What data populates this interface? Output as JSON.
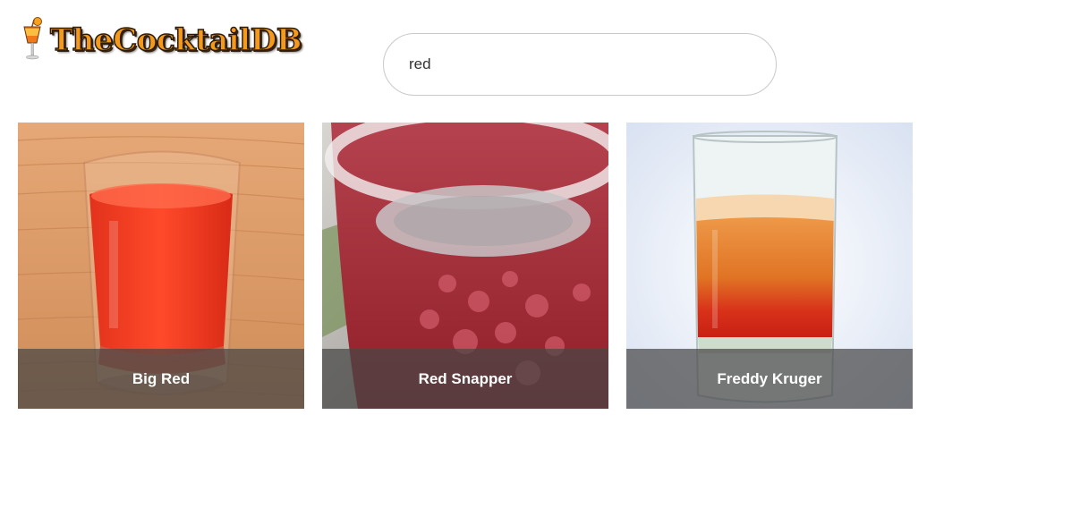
{
  "header": {
    "logo_text": "TheCocktailDB",
    "logo_icon": "cocktail-glass-icon"
  },
  "search": {
    "value": "red",
    "placeholder": ""
  },
  "results": [
    {
      "name": "Big Red"
    },
    {
      "name": "Red Snapper"
    },
    {
      "name": "Freddy Kruger"
    }
  ],
  "colors": {
    "logo_orange": "#f39a1c",
    "caption_overlay": "#464646",
    "search_border": "#c9c9c9"
  }
}
